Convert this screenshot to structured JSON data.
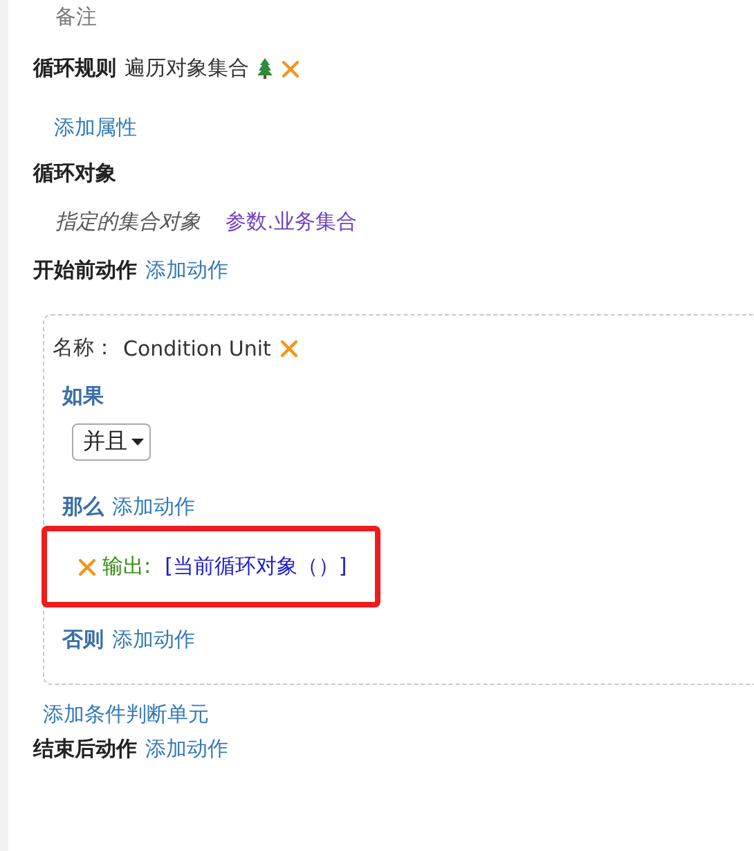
{
  "note_label": "备注",
  "loop_rule": {
    "label": "循环规则",
    "value": "遍历对象集合"
  },
  "add_property": "添加属性",
  "loop_object": {
    "label": "循环对象",
    "field": "指定的集合对象",
    "value": "参数.业务集合"
  },
  "before_start": {
    "label": "开始前动作",
    "link": "添加动作"
  },
  "condition_unit": {
    "name_label": "名称：",
    "name": "Condition Unit",
    "if_label": "如果",
    "operator": "并且",
    "then_label": "那么",
    "then_link": "添加动作",
    "then_actions": [
      {
        "label": "输出:",
        "value": "[当前循环对象（）]",
        "highlighted": true
      }
    ],
    "else_label": "否则",
    "else_link": "添加动作"
  },
  "add_condition_unit": "添加条件判断单元",
  "after_end": {
    "label": "结束后动作",
    "link": "添加动作"
  }
}
